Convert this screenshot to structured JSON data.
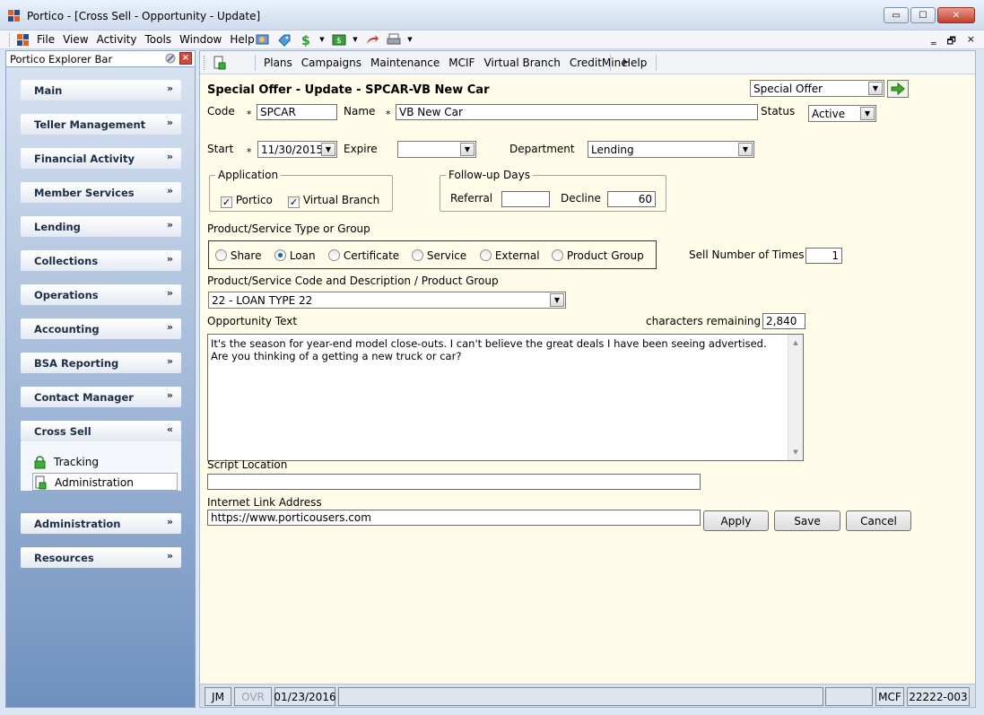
{
  "window": {
    "title": "Portico - [Cross Sell - Opportunity - Update]",
    "buttons": {
      "minimize": "▭",
      "maximize": "☐",
      "close": "✕"
    }
  },
  "menu": {
    "items": [
      "File",
      "View",
      "Activity",
      "Tools",
      "Window",
      "Help"
    ],
    "mdi": {
      "minimize": "‗",
      "restore": "🗗",
      "close": "×"
    }
  },
  "explorer": {
    "title": "Portico Explorer Bar",
    "groups": [
      "Main",
      "Teller Management",
      "Financial Activity",
      "Member Services",
      "Lending",
      "Collections",
      "Operations",
      "Accounting",
      "BSA Reporting",
      "Contact Manager"
    ],
    "expanded_group": "Cross Sell",
    "sub_items": [
      "Tracking",
      "Administration"
    ],
    "bottom_groups": [
      "Administration",
      "Resources"
    ]
  },
  "toolbar": {
    "items": [
      "Plans",
      "Campaigns",
      "Maintenance",
      "MCIF",
      "Virtual Branch",
      "CreditMine"
    ],
    "help": "Help"
  },
  "form": {
    "heading": "Special Offer - Update - SPCAR-VB New Car",
    "offer_type": "Special Offer",
    "code_label": "Code",
    "code_value": "SPCAR",
    "name_label": "Name",
    "name_value": "VB New Car",
    "status_label": "Status",
    "status_value": "Active",
    "required_mark": "*",
    "start_label": "Start",
    "start_value": "11/30/2015",
    "expire_label": "Expire",
    "expire_value": "",
    "department_label": "Department",
    "department_value": "Lending",
    "application_title": "Application",
    "app_portico": "Portico",
    "app_vb": "Virtual Branch",
    "followup_title": "Follow-up Days",
    "referral_label": "Referral",
    "referral_value": "",
    "decline_label": "Decline",
    "decline_value": "60",
    "type_label": "Product/Service Type or Group",
    "types": [
      "Share",
      "Loan",
      "Certificate",
      "Service",
      "External",
      "Product Group"
    ],
    "selected_type": "Loan",
    "sell_label": "Sell Number of Times",
    "sell_value": "1",
    "code_desc_label": "Product/Service Code and Description / Product Group",
    "code_desc_value": "22 - LOAN TYPE 22",
    "opp_text_label": "Opportunity Text",
    "chars_label": "characters remaining",
    "chars_value": "2,840",
    "opp_text": "It's the season for year-end model close-outs. I can't believe the great deals I have been seeing advertised.  Are you thinking of a getting a new truck or car?",
    "script_label": "Script Location",
    "script_value": "",
    "link_label": "Internet Link Address",
    "link_value": "https://www.porticousers.com",
    "apply": "Apply",
    "save": "Save",
    "cancel": "Cancel"
  },
  "status": {
    "user": "JM",
    "ovr": "OVR",
    "date": "01/23/2016",
    "mode": "MCF",
    "id": "22222-003"
  },
  "colors": {
    "form_bg": "#fffbe9",
    "explorer_top": "#d9e4f2",
    "explorer_bottom": "#6f90bf",
    "radio_dot": "#1f5bb8",
    "go_arrow": "#3fae2a"
  }
}
